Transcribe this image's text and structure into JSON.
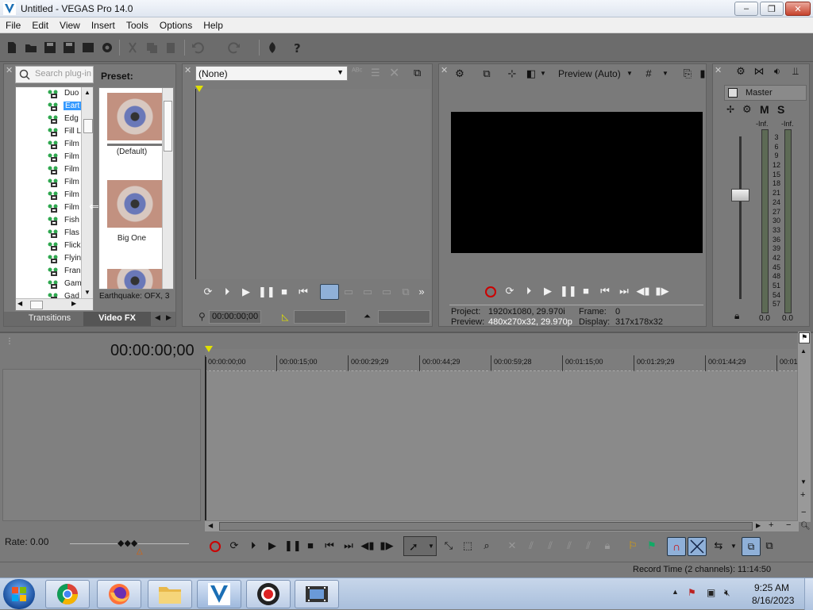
{
  "window": {
    "title": "Untitled - VEGAS Pro 14.0",
    "min": "–",
    "max": "❐",
    "close": "✕"
  },
  "menu": [
    "File",
    "Edit",
    "View",
    "Insert",
    "Tools",
    "Options",
    "Help"
  ],
  "plugin_panel": {
    "search_placeholder": "Search plug-in",
    "tree_items": [
      "Duo",
      "Eart",
      "Edg",
      "Fill L",
      "Film",
      "Film",
      "Film",
      "Film",
      "Film",
      "Film",
      "Fish",
      "Flas",
      "Flick",
      "Flyin",
      "Fran",
      "Gam",
      "Gad"
    ],
    "selected_index": 1,
    "tabs": [
      "Transitions",
      "Video FX"
    ]
  },
  "preset_panel": {
    "heading": "Preset:",
    "presets": [
      "(Default)",
      "Big One"
    ],
    "footer": "Earthquake: OFX, 3"
  },
  "trimmer": {
    "dropdown_value": "(None)",
    "timecode": "00:00:00;00"
  },
  "preview": {
    "mode": "Preview (Auto)",
    "project_label": "Project:",
    "project_value": "1920x1080, 29.970i",
    "preview_label": "Preview:",
    "preview_value": "480x270x32, 29.970p",
    "frame_label": "Frame:",
    "frame_value": "0",
    "display_label": "Display:",
    "display_value": "317x178x32"
  },
  "master": {
    "title": "Master",
    "m": "M",
    "s": "S",
    "inf_left": "-Inf.",
    "inf_right": "-Inf.",
    "scale": [
      "3",
      "6",
      "9",
      "12",
      "15",
      "18",
      "21",
      "24",
      "27",
      "30",
      "33",
      "36",
      "39",
      "42",
      "45",
      "48",
      "51",
      "54",
      "57"
    ],
    "level_left": "0.0",
    "level_right": "0.0"
  },
  "timeline": {
    "timecode": "00:00:00;00",
    "ruler": [
      "00:00:00;00",
      "00:00:15;00",
      "00:00:29;29",
      "00:00:44;29",
      "00:00:59;28",
      "00:01:15;00",
      "00:01:29;29",
      "00:01:44;29",
      "00:01:5"
    ],
    "rate": "Rate: 0.00"
  },
  "status": {
    "record_time": "Record Time (2 channels): 11:14:50"
  },
  "taskbar": {
    "time": "9:25 AM",
    "date": "8/16/2023"
  }
}
